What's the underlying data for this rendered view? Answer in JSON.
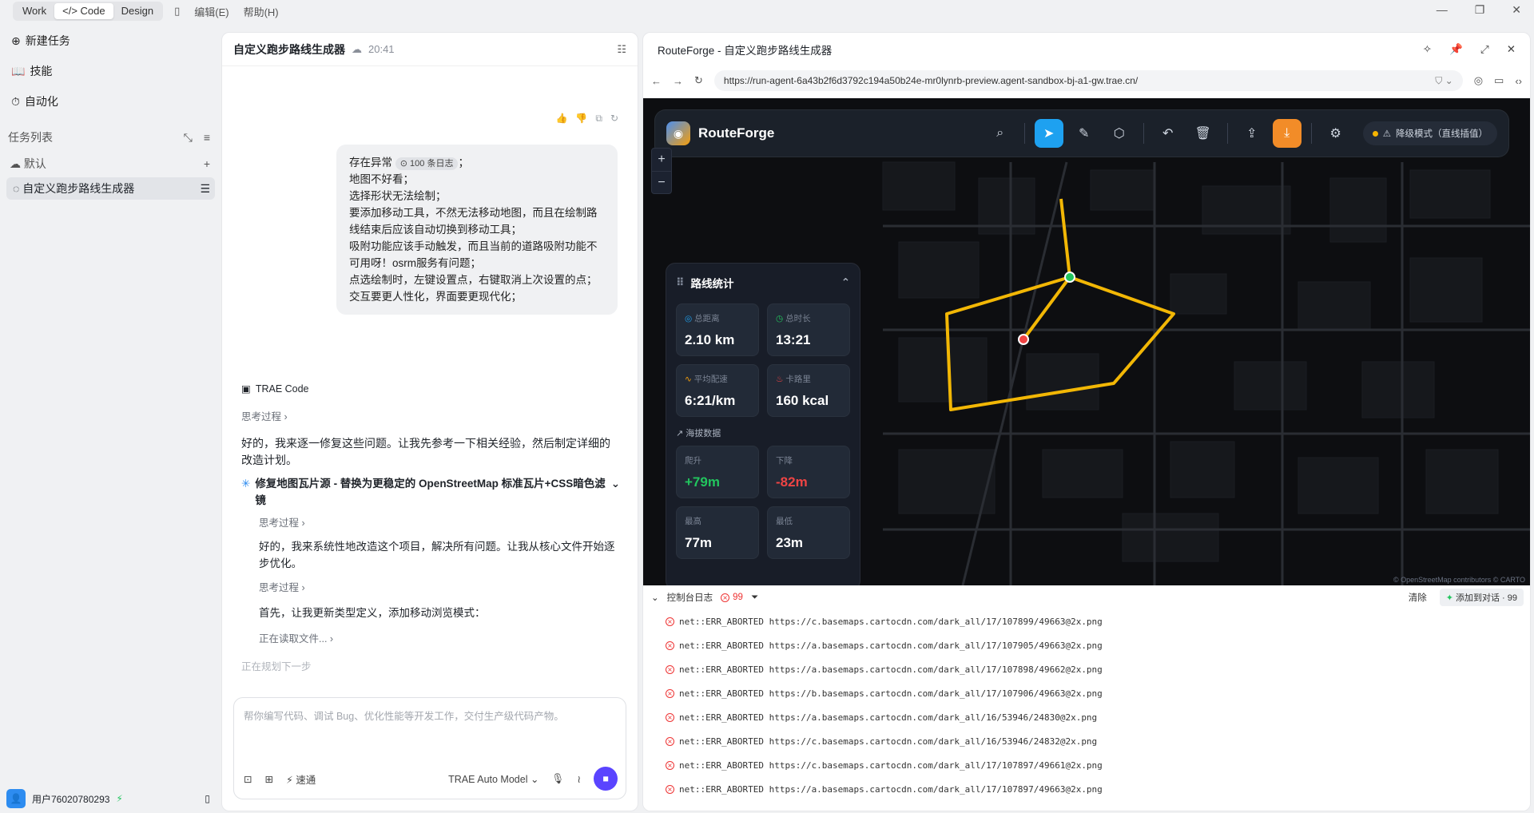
{
  "topbar": {
    "modes": [
      "Work",
      "Code",
      "Design"
    ],
    "code_label": "</> Code",
    "menu": [
      "编辑(E)",
      "帮助(H)"
    ]
  },
  "sidebar": {
    "new_task": "新建任务",
    "skills": "技能",
    "automation": "自动化",
    "task_list": "任务列表",
    "default_group": "默认",
    "task": "自定义跑步路线生成器",
    "user": "用户76020780293"
  },
  "chat": {
    "title": "自定义跑步路线生成器",
    "time": "20:41",
    "bubble": {
      "line1_pre": "存在异常",
      "pill": "100 条日志",
      "line1_post": "；",
      "lines": [
        "地图不好看；",
        "选择形状无法绘制；",
        "要添加移动工具，不然无法移动地图，而且在绘制路线结束后应该自动切换到移动工具；",
        "吸附功能应该手动触发，而且当前的道路吸附功能不可用呀！osrm服务有问题；",
        "点选绘制时，左键设置点，右键取消上次设置的点；",
        "交互要更人性化，界面要更现代化；"
      ]
    },
    "agent_name": "TRAE Code",
    "thinking": "思考过程",
    "reply1": "好的，我来逐一修复这些问题。让我先参考一下相关经验，然后制定详细的改造计划。",
    "step_title": "修复地图瓦片源 - 替换为更稳定的 OpenStreetMap 标准瓦片+CSS暗色滤镜",
    "thinking2": "思考过程",
    "reply2": "好的，我来系统性地改造这个项目，解决所有问题。让我从核心文件开始逐步优化。",
    "thinking3": "思考过程",
    "reply3": "首先，让我更新类型定义，添加移动浏览模式：",
    "reading": "正在读取文件...",
    "planning": "正在规划下一步",
    "input_placeholder": "帮你编写代码、调试 Bug、优化性能等开发工作，交付生产级代码产物。",
    "speed": "速通",
    "model": "TRAE Auto Model"
  },
  "preview": {
    "title": "RouteForge - 自定义跑步路线生成器",
    "url": "https://run-agent-6a43b2f6d3792c194a50b24e-mr0lynrb-preview.agent-sandbox-bj-a1-gw.trae.cn/",
    "brand": "RouteForge",
    "status": "降级模式（直线插值）",
    "stats_title": "路线统计",
    "distance_label": "总距离",
    "distance": "2.10 km",
    "duration_label": "总时长",
    "duration": "13:21",
    "pace_label": "平均配速",
    "pace": "6:21/km",
    "calories_label": "卡路里",
    "calories": "160 kcal",
    "elevation_title": "海拔数据",
    "ascent_label": "爬升",
    "ascent": "+79m",
    "descent_label": "下降",
    "descent": "-82m",
    "max_label": "最高",
    "max": "77m",
    "min_label": "最低",
    "min": "23m",
    "attribution": "© OpenStreetMap contributors © CARTO"
  },
  "console": {
    "title": "控制台日志",
    "error_count": "99",
    "clear": "清除",
    "add_to_chat": "添加到对话 · 99",
    "logs": [
      "net::ERR_ABORTED https://c.basemaps.cartocdn.com/dark_all/17/107899/49663@2x.png",
      "net::ERR_ABORTED https://a.basemaps.cartocdn.com/dark_all/17/107905/49663@2x.png",
      "net::ERR_ABORTED https://a.basemaps.cartocdn.com/dark_all/17/107898/49662@2x.png",
      "net::ERR_ABORTED https://b.basemaps.cartocdn.com/dark_all/17/107906/49663@2x.png",
      "net::ERR_ABORTED https://a.basemaps.cartocdn.com/dark_all/16/53946/24830@2x.png",
      "net::ERR_ABORTED https://c.basemaps.cartocdn.com/dark_all/16/53946/24832@2x.png",
      "net::ERR_ABORTED https://c.basemaps.cartocdn.com/dark_all/17/107897/49661@2x.png",
      "net::ERR_ABORTED https://a.basemaps.cartocdn.com/dark_all/17/107897/49663@2x.png"
    ]
  },
  "colors": {
    "route": "#f2b705",
    "accent": "#1ea1f0",
    "send": "#5a44ff",
    "error": "#ee3333"
  }
}
